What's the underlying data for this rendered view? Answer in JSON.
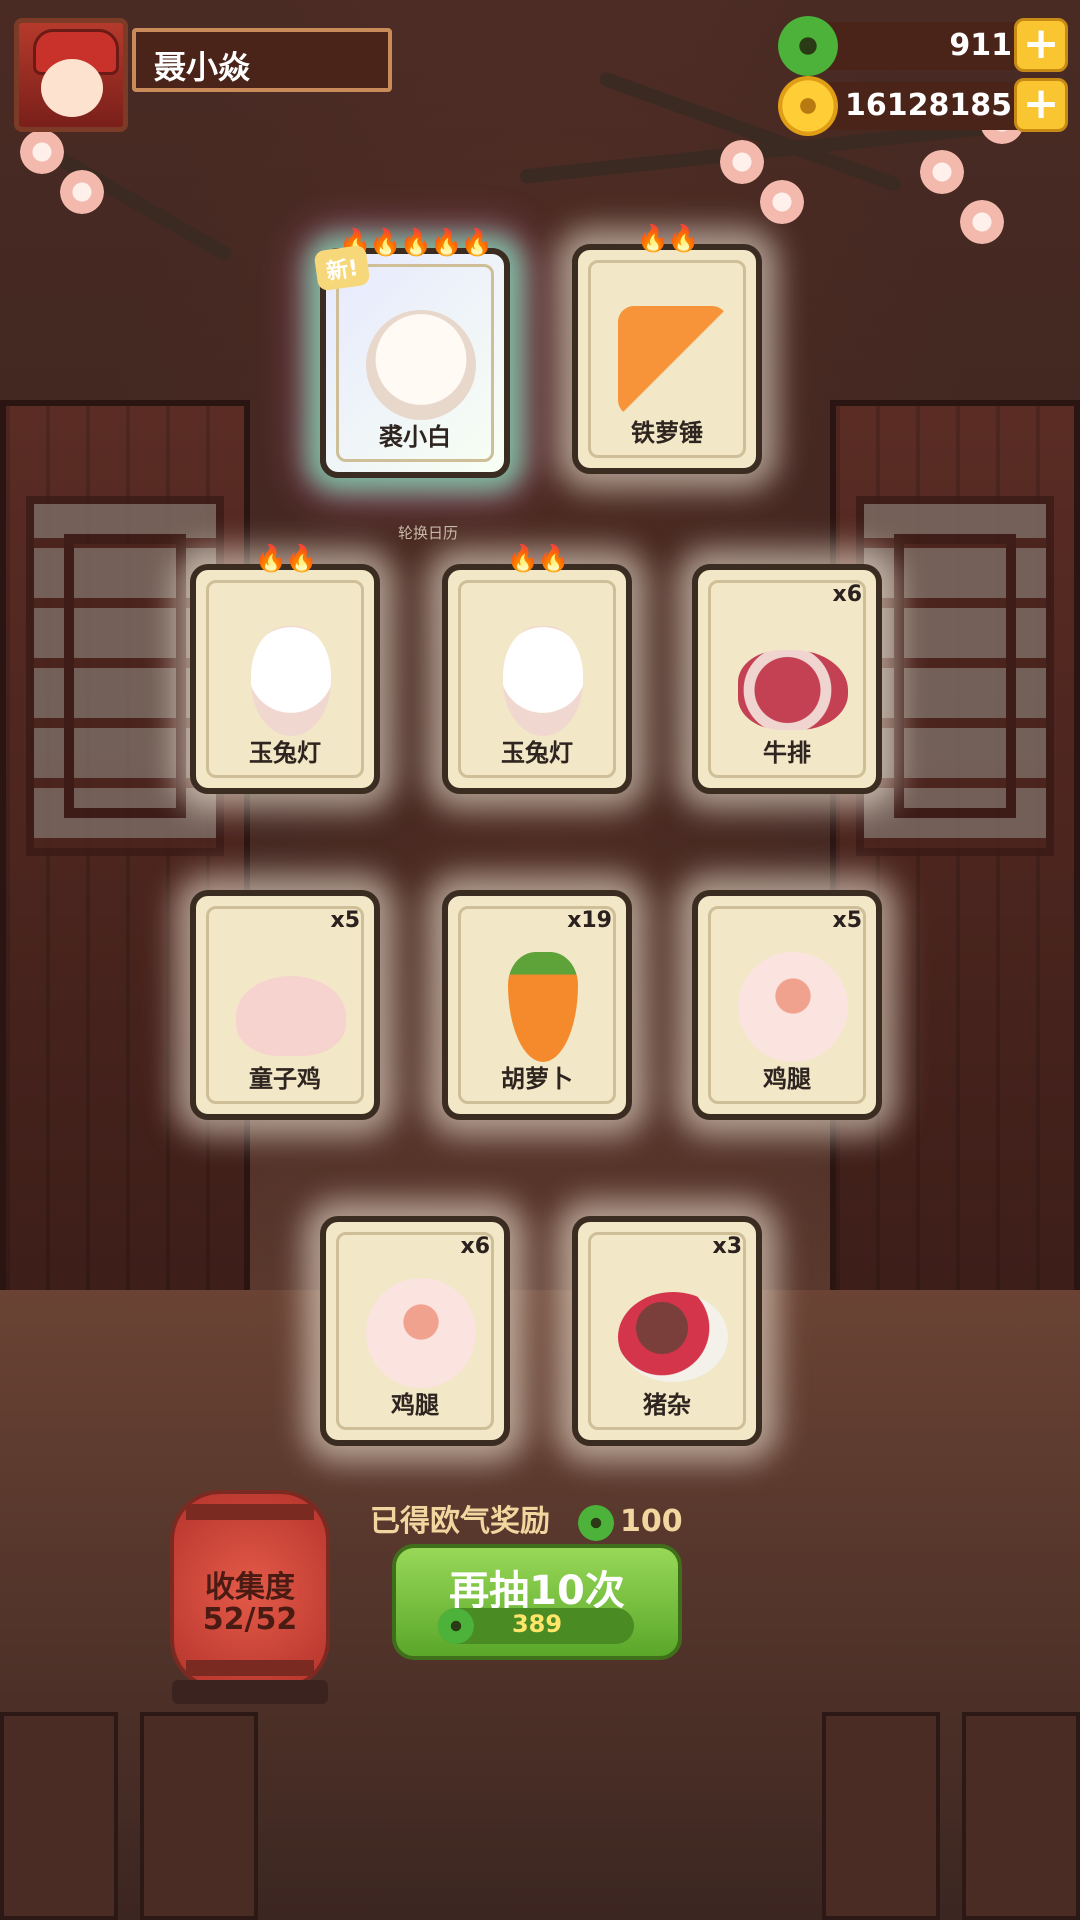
{
  "player": {
    "name": "聂小焱",
    "avatar": "chef-avatar"
  },
  "currency": {
    "jade": "911",
    "gold": "16128185",
    "jade_icon": "jade-coin-icon",
    "gold_icon": "gold-coin-icon"
  },
  "cards": [
    {
      "label": "裘小白",
      "flames": "🔥🔥🔥🔥🔥",
      "qty": "",
      "badge": "新!",
      "art": "cat"
    },
    {
      "label": "铁萝锤",
      "flames": "🔥🔥",
      "qty": "",
      "badge": "",
      "art": "hammer"
    },
    {
      "label": "玉兔灯",
      "flames": "🔥🔥",
      "qty": "",
      "badge": "",
      "art": "lantern"
    },
    {
      "label": "玉兔灯",
      "flames": "🔥🔥",
      "qty": "",
      "badge": "",
      "art": "lantern"
    },
    {
      "label": "牛排",
      "flames": "",
      "qty": "x6",
      "badge": "",
      "art": "steak"
    },
    {
      "label": "童子鸡",
      "flames": "",
      "qty": "x5",
      "badge": "",
      "art": "chicken"
    },
    {
      "label": "胡萝卜",
      "flames": "",
      "qty": "x19",
      "badge": "",
      "art": "carrot"
    },
    {
      "label": "鸡腿",
      "flames": "",
      "qty": "x5",
      "badge": "",
      "art": "drumstick"
    },
    {
      "label": "鸡腿",
      "flames": "",
      "qty": "x6",
      "badge": "",
      "art": "drumstick"
    },
    {
      "label": "猪杂",
      "flames": "",
      "qty": "x3",
      "badge": "",
      "art": "offal"
    }
  ],
  "background_sign": "轮换日历",
  "collection": {
    "title": "收集度",
    "value": "52/52"
  },
  "reward": {
    "label": "已得欧气奖励",
    "value": "100"
  },
  "draw_button": {
    "label": "再抽10次",
    "cost": "389"
  },
  "colors": {
    "flame": "#f0541e",
    "button_green": "#6db534",
    "card_bg": "#f2e7c6"
  }
}
